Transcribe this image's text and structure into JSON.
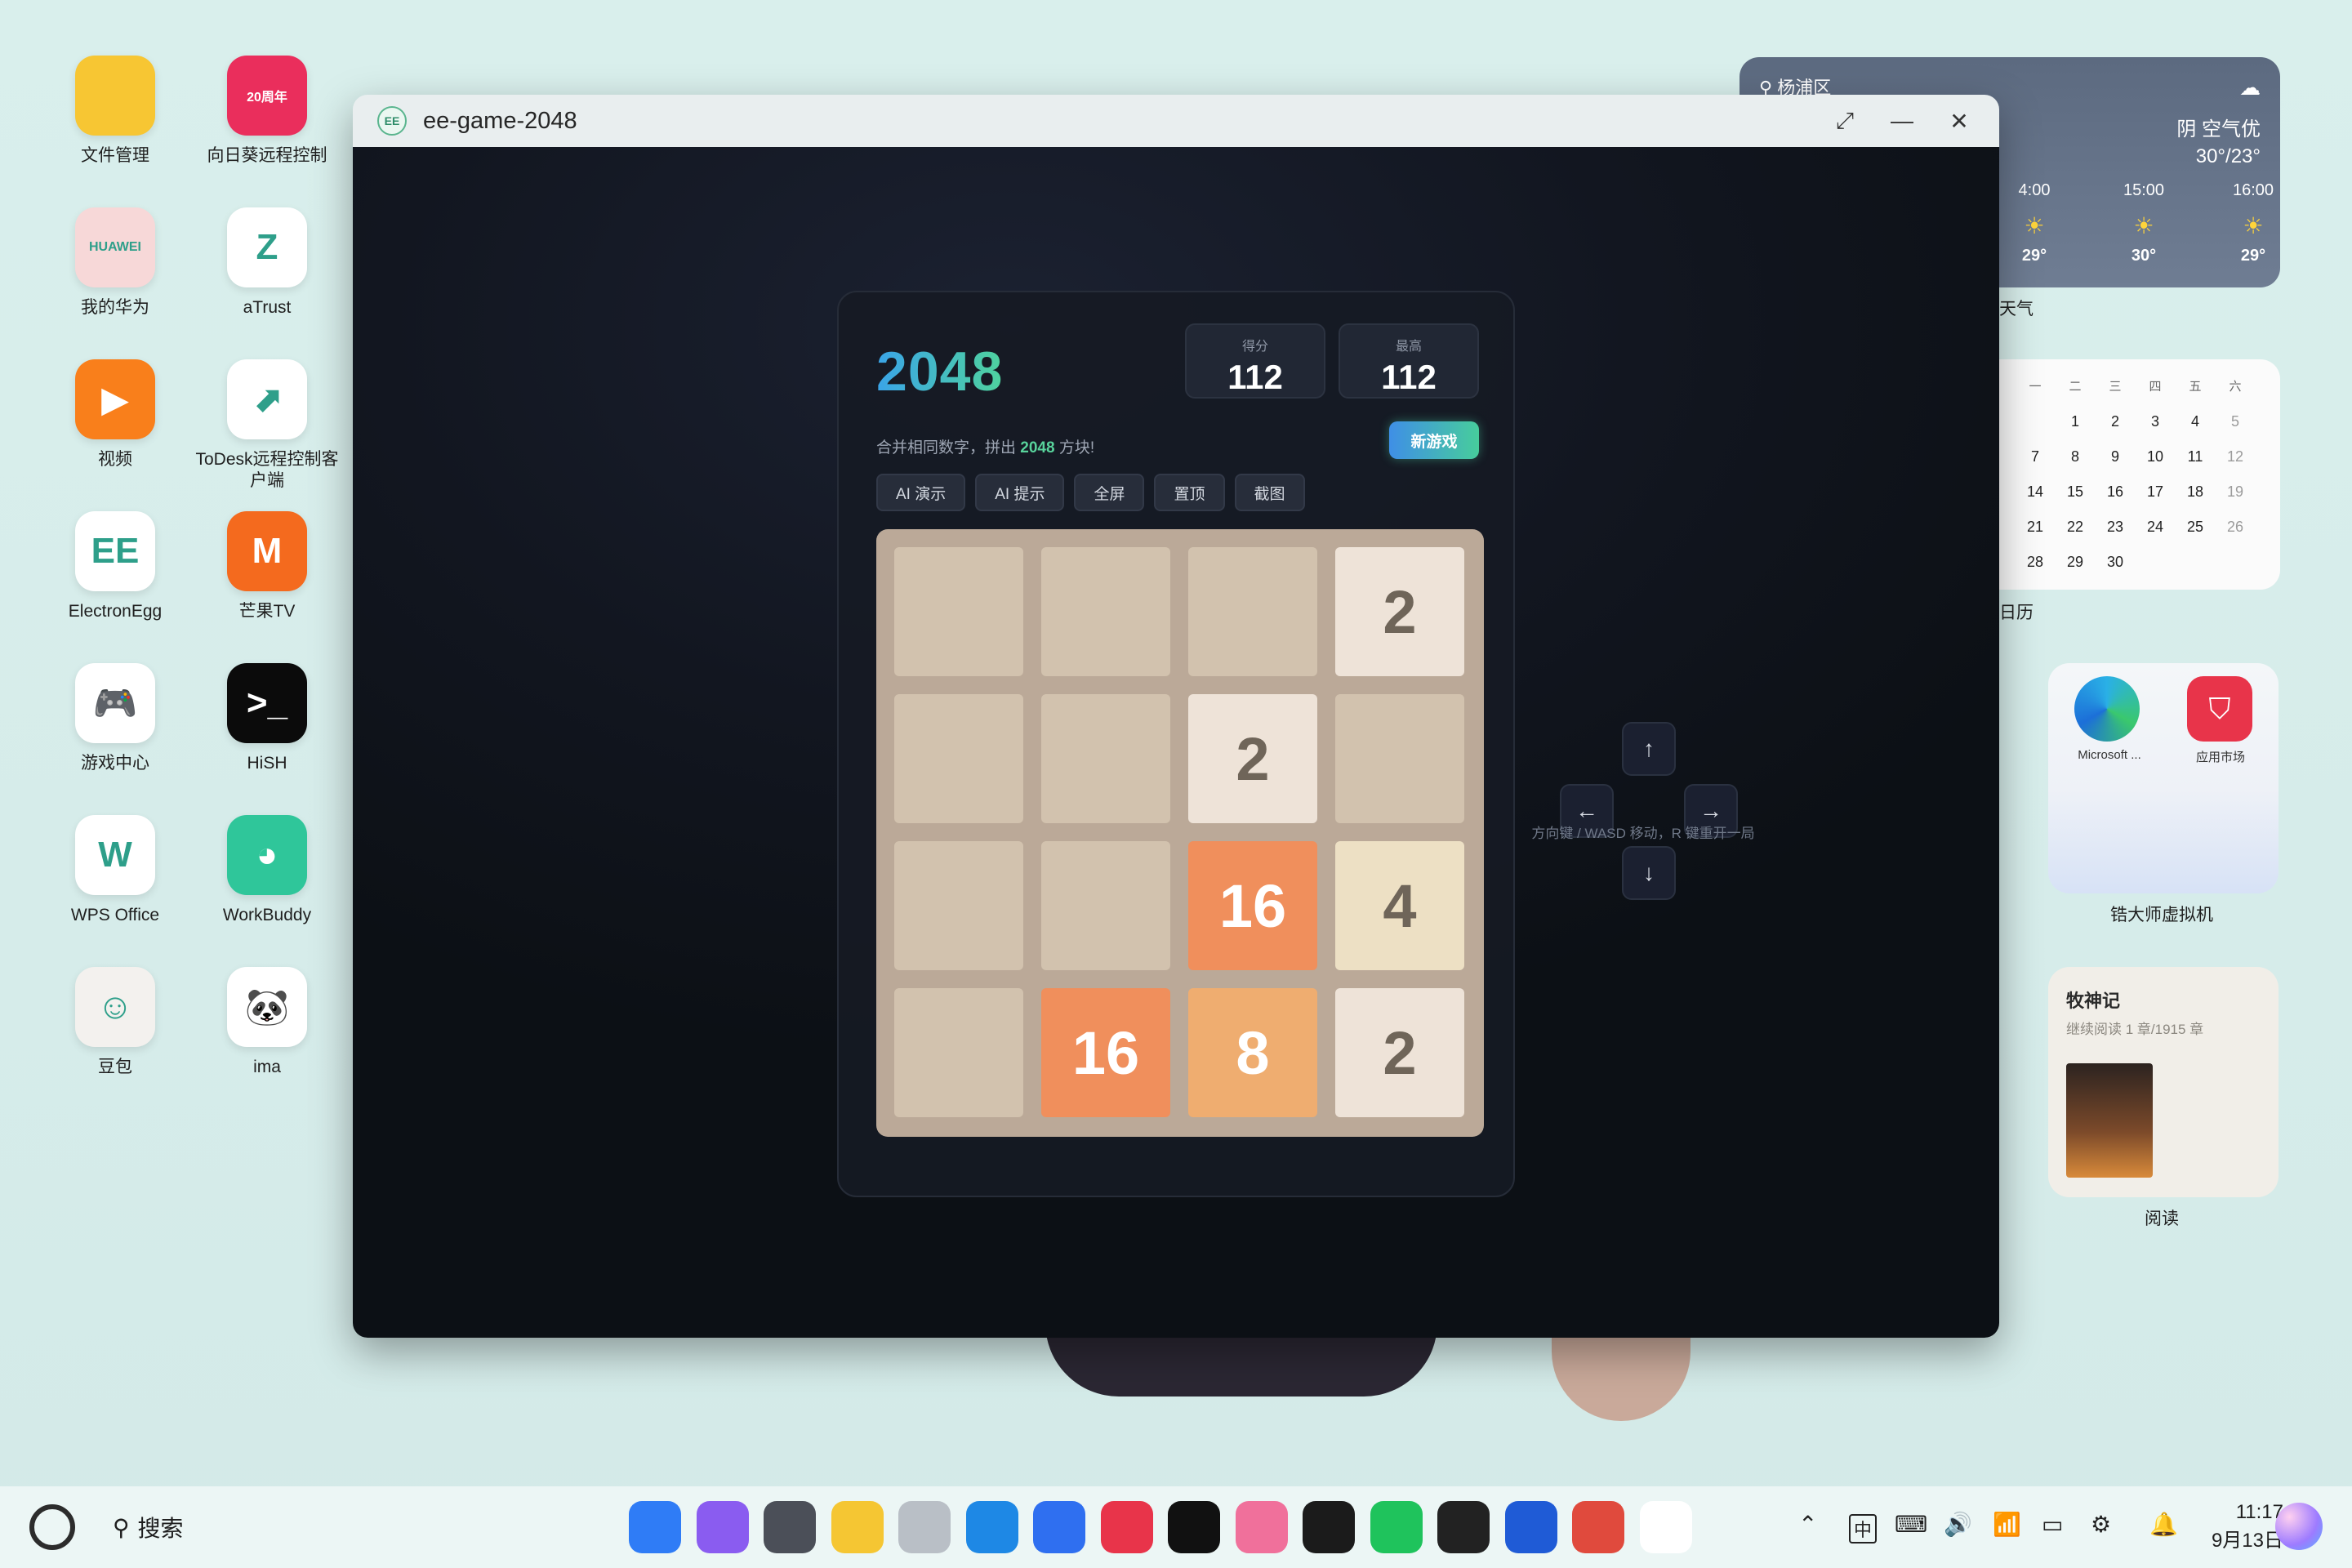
{
  "desktop_icons": [
    {
      "label": "文件管理",
      "icon": "folder-icon",
      "color": "#f7c633",
      "glyph": ""
    },
    {
      "label": "向日葵远程控制",
      "icon": "sunflower-icon",
      "color": "#ea2e5c",
      "glyph": "20周年"
    },
    {
      "label": "我的华为",
      "icon": "huawei-icon",
      "color": "#f7d8d8",
      "glyph": "HUAWEI"
    },
    {
      "label": "aTrust",
      "icon": "atrust-icon",
      "color": "#ffffff",
      "glyph": "Z"
    },
    {
      "label": "视频",
      "icon": "video-play-icon",
      "color": "#f97f1b",
      "glyph": "▶"
    },
    {
      "label": "ToDesk远程控制客户端",
      "icon": "todesk-icon",
      "color": "#ffffff",
      "glyph": "⬈"
    },
    {
      "label": "ElectronEgg",
      "icon": "electronegg-icon",
      "color": "#ffffff",
      "glyph": "EE"
    },
    {
      "label": "芒果TV",
      "icon": "mangotv-icon",
      "color": "#f46a1e",
      "glyph": "M"
    },
    {
      "label": "游戏中心",
      "icon": "gamepad-icon",
      "color": "#ffffff",
      "glyph": "🎮"
    },
    {
      "label": "HiSH",
      "icon": "terminal-icon",
      "color": "#0b0b0b",
      "glyph": ">_"
    },
    {
      "label": "WPS Office",
      "icon": "wps-icon",
      "color": "#ffffff",
      "glyph": "W"
    },
    {
      "label": "WorkBuddy",
      "icon": "workbuddy-icon",
      "color": "#2fc69a",
      "glyph": "◕"
    },
    {
      "label": "豆包",
      "icon": "doubao-avatar-icon",
      "color": "#f3f1ee",
      "glyph": "☺"
    },
    {
      "label": "ima",
      "icon": "panda-icon",
      "color": "#ffffff",
      "glyph": "🐼"
    }
  ],
  "window": {
    "title": "ee-game-2048",
    "logo_text": "EE"
  },
  "game": {
    "title": "2048",
    "score_label": "得分",
    "score": "112",
    "best_label": "最高",
    "best": "112",
    "subtitle_prefix": "合并相同数字，拼出",
    "subtitle_highlight": "2048",
    "subtitle_suffix": "方块!",
    "new_game": "新游戏",
    "toolbar": [
      "AI 演示",
      "AI 提示",
      "全屏",
      "置顶",
      "截图"
    ],
    "board": [
      [
        0,
        0,
        0,
        2
      ],
      [
        0,
        0,
        2,
        0
      ],
      [
        0,
        0,
        16,
        4
      ],
      [
        0,
        16,
        8,
        2
      ]
    ],
    "arrows": {
      "up": "↑",
      "down": "↓",
      "left": "←",
      "right": "→"
    },
    "hint": "方向键 / WASD 移动，R 键重开一局"
  },
  "weather": {
    "location": "杨浦区",
    "condition": "阴 空气优",
    "range": "30°/23°",
    "hours": [
      {
        "time": "4:00",
        "temp": "29°",
        "icon": "cloud-sun-icon"
      },
      {
        "time": "15:00",
        "temp": "30°",
        "icon": "sun-icon"
      },
      {
        "time": "16:00",
        "temp": "29°",
        "icon": "sun-icon"
      }
    ],
    "label": "天气"
  },
  "calendar": {
    "label": "日历",
    "headers": [
      "一",
      "二",
      "三",
      "四",
      "五",
      "六"
    ],
    "rows": [
      [
        "",
        "1",
        "2",
        "3",
        "4",
        "5"
      ],
      [
        "7",
        "8",
        "9",
        "10",
        "11",
        "12"
      ],
      [
        "14",
        "15",
        "16",
        "17",
        "18",
        "19"
      ],
      [
        "21",
        "22",
        "23",
        "24",
        "25",
        "26"
      ],
      [
        "28",
        "29",
        "30",
        "",
        "",
        ""
      ]
    ]
  },
  "app_widget": {
    "label": "锆大师虚拟机",
    "apps": [
      {
        "name": "Microsoft ...",
        "icon": "edge-icon"
      },
      {
        "name": "应用市场",
        "icon": "appgallery-icon"
      }
    ]
  },
  "read_widget": {
    "label": "阅读",
    "book": "牧神记",
    "progress": "继续阅读 1 章/1915 章"
  },
  "taskbar": {
    "search": "搜索",
    "dock": [
      {
        "icon": "app-grid-icon",
        "color": "#2f7cf6"
      },
      {
        "icon": "multiwindow-icon",
        "color": "#8a5cf0"
      },
      {
        "icon": "settings-icon",
        "color": "#4b4f58"
      },
      {
        "icon": "files-icon",
        "color": "#f5c633"
      },
      {
        "icon": "trash-icon",
        "color": "#b9bfc6"
      },
      {
        "icon": "browser-icon",
        "color": "#1e88e5"
      },
      {
        "icon": "mail-icon",
        "color": "#2f6ff0"
      },
      {
        "icon": "appgallery-icon",
        "color": "#e8344a"
      },
      {
        "icon": "tiktok-icon",
        "color": "#111111"
      },
      {
        "icon": "bilibili-icon",
        "color": "#f0709b"
      },
      {
        "icon": "terminal-icon",
        "color": "#1b1b1b"
      },
      {
        "icon": "wechat-icon",
        "color": "#1fc35c"
      },
      {
        "icon": "layers-icon",
        "color": "#222222"
      },
      {
        "icon": "flight-icon",
        "color": "#1f5bd6"
      },
      {
        "icon": "sync-icon",
        "color": "#e04a3d"
      },
      {
        "icon": "electronegg-icon",
        "color": "#ffffff"
      }
    ],
    "time": "11:17",
    "date": "9月13日",
    "ime": "中"
  }
}
